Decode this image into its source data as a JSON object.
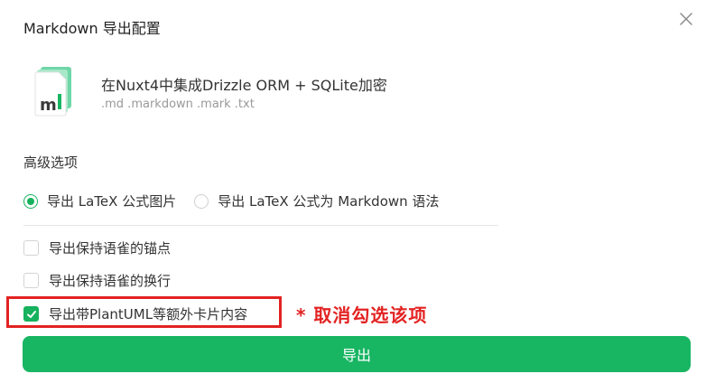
{
  "dialog": {
    "title": "Markdown 导出配置"
  },
  "file": {
    "icon_letter": "m",
    "name": "在Nuxt4中集成Drizzle ORM + SQLite加密",
    "extensions": ".md .markdown .mark .txt"
  },
  "advanced": {
    "title": "高级选项",
    "radio_options": [
      {
        "label": "导出 LaTeX 公式图片",
        "checked": true
      },
      {
        "label": "导出 LaTeX 公式为 Markdown 语法",
        "checked": false
      }
    ],
    "checkbox_options": [
      {
        "label": "导出保持语雀的锚点",
        "checked": false
      },
      {
        "label": "导出保持语雀的换行",
        "checked": false
      },
      {
        "label": "导出带PlantUML等额外卡片内容",
        "checked": true
      }
    ]
  },
  "annotation": {
    "text": "* 取消勾选该项",
    "color": "#e32222"
  },
  "export_button": {
    "label": "导出"
  },
  "colors": {
    "accent": "#16b25d",
    "button": "#18b563",
    "highlight": "#e32222"
  }
}
